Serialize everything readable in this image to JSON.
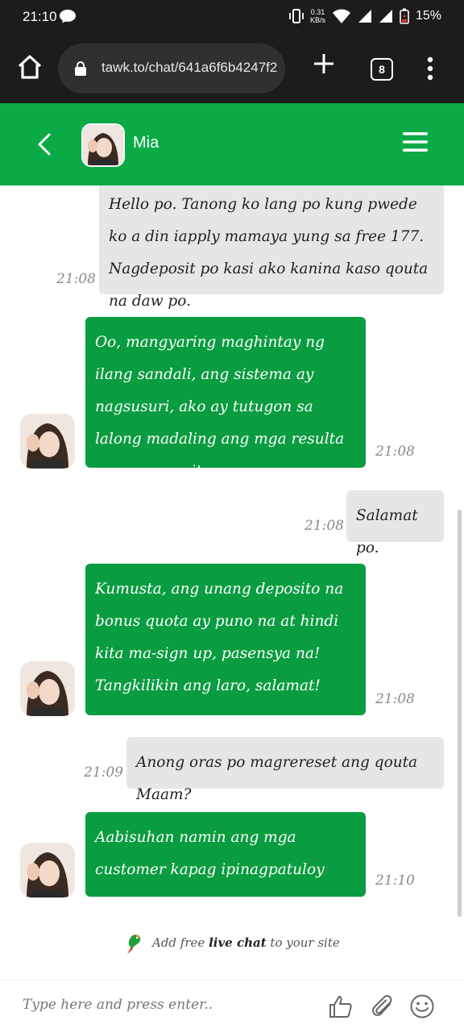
{
  "status_bar": {
    "time": "21:10",
    "net_speed_value": "0.31",
    "net_speed_unit": "KB/s",
    "battery": "15%"
  },
  "browser": {
    "url": "tawk.to/chat/641a6f6b4247f2",
    "tab_count": "8"
  },
  "chat_header": {
    "agent_name": "Mia"
  },
  "messages": [
    {
      "direction": "in",
      "text": "Hello po. Tanong ko lang po kung pwede ko a din iapply mamaya yung sa free 177. Nagdeposit po kasi ako kanina kaso qouta na daw po.",
      "time": "21:08"
    },
    {
      "direction": "out",
      "text": "Oo, mangyaring maghintay ng ilang sandali, ang sistema ay nagsusuri, ako ay tutugon sa lalong madaling ang mga resulta ay magagamit.",
      "time": "21:08"
    },
    {
      "direction": "in",
      "text": "Salamat po.",
      "time": "21:08"
    },
    {
      "direction": "out",
      "text": "Kumusta, ang unang deposito na bonus quota ay puno na at hindi kita ma-sign up, pasensya na! Tangkilikin ang laro, salamat!",
      "time": "21:08"
    },
    {
      "direction": "in",
      "text": "Anong oras po magrereset ang qouta Maam?",
      "time": "21:09"
    },
    {
      "direction": "out",
      "text": "Aabisuhan namin ang mga customer kapag ipinagpatuloy ang promosyon",
      "time": "21:10"
    }
  ],
  "branding": {
    "prefix": "Add free",
    "bold": "live chat",
    "suffix": "to your site"
  },
  "composer": {
    "placeholder": "Type here and press enter.."
  },
  "colors": {
    "header_green": "#0aaa47",
    "agent_bubble": "#0a9c40",
    "visitor_bubble": "#e6e6e6",
    "status_bar": "#1c1c1c"
  },
  "icons": [
    "message-icon",
    "vibrate-icon",
    "wifi-icon",
    "signal-icon",
    "battery-icon",
    "home-icon",
    "lock-icon",
    "plus-icon",
    "tabs-icon",
    "more-icon",
    "back-icon",
    "menu-icon",
    "thumbs-up-icon",
    "attachment-icon",
    "emoji-icon",
    "tawk-bird-icon"
  ]
}
